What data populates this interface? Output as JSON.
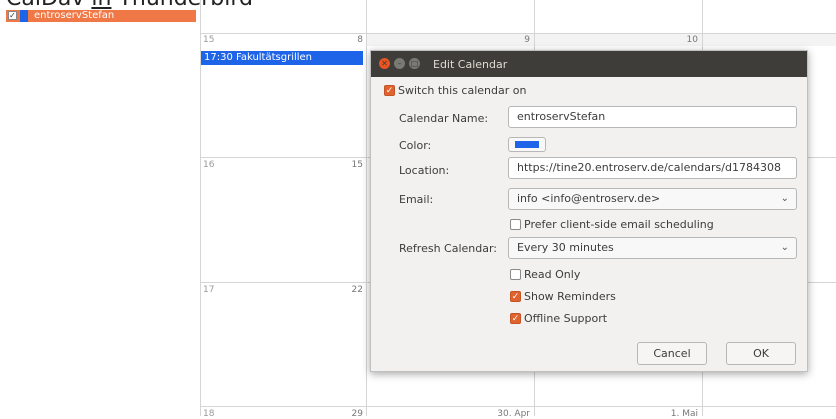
{
  "page": {
    "heading_part1": "CalDav ",
    "heading_part2": "in",
    "heading_part3": " Thunderbird"
  },
  "sidebar": {
    "calendars": [
      {
        "name": "entroservStefan",
        "color": "#1e64e8",
        "checked": true
      }
    ]
  },
  "month_grid": {
    "rows": [
      {
        "week": "15",
        "days": [
          "8",
          "9",
          "10"
        ]
      },
      {
        "week": "16",
        "days": [
          "15",
          "",
          ""
        ]
      },
      {
        "week": "17",
        "days": [
          "22",
          "",
          ""
        ]
      },
      {
        "week": "18",
        "days": [
          "29",
          "30. Apr",
          "1. Mai"
        ]
      }
    ],
    "event": {
      "label": "17:30 Fakultätsgrillen",
      "color": "#1e64e8"
    }
  },
  "dialog": {
    "title": "Edit Calendar",
    "switch_on_label": "Switch this calendar on",
    "calendar_name_label": "Calendar Name:",
    "calendar_name_value": "entroservStefan",
    "color_label": "Color:",
    "color_value": "#1e64e8",
    "location_label": "Location:",
    "location_value": "https://tine20.entroserv.de/calendars/d1784308",
    "email_label": "Email:",
    "email_value": "info <info@entroserv.de>",
    "prefer_client_label": "Prefer client-side email scheduling",
    "refresh_label": "Refresh Calendar:",
    "refresh_value": "Every 30 minutes",
    "read_only_label": "Read Only",
    "show_reminders_label": "Show Reminders",
    "offline_support_label": "Offline Support",
    "cancel_label": "Cancel",
    "ok_label": "OK",
    "accent": "#e0632f"
  }
}
